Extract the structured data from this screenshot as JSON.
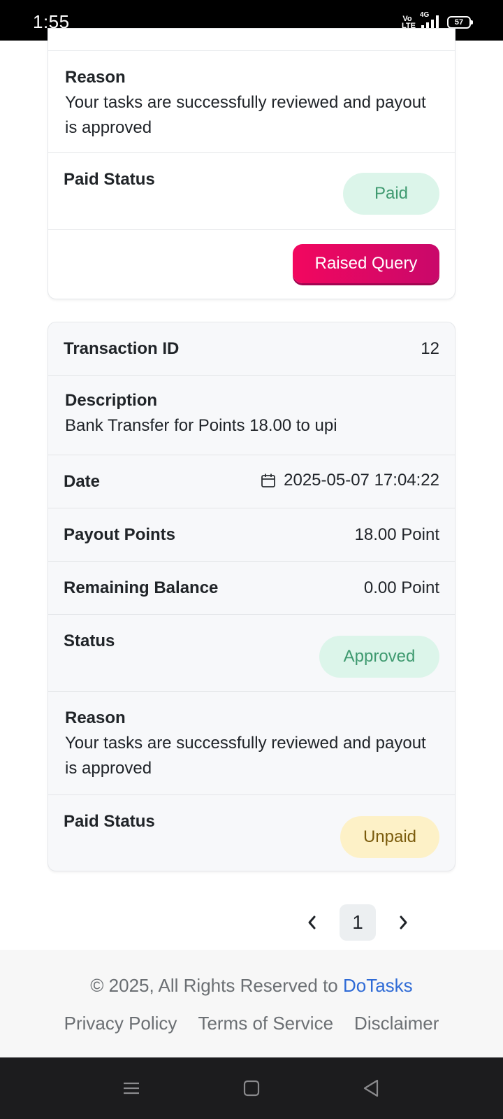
{
  "status_bar": {
    "time": "1:55",
    "volte": "Vo\nLTE",
    "network": "4G",
    "battery": "57"
  },
  "card_top": {
    "reason_label": "Reason",
    "reason_text": "Your tasks are successfully reviewed and payout is approved",
    "paid_status_label": "Paid Status",
    "paid_status_value": "Paid",
    "raise_query_label": "Raised Query"
  },
  "card_bottom": {
    "transaction_id_label": "Transaction ID",
    "transaction_id_value": "12",
    "description_label": "Description",
    "description_value": "Bank Transfer for Points 18.00 to upi",
    "date_label": "Date",
    "date_value": "2025-05-07 17:04:22",
    "payout_points_label": "Payout Points",
    "payout_points_value": "18.00 Point",
    "remaining_balance_label": "Remaining Balance",
    "remaining_balance_value": "0.00 Point",
    "status_label": "Status",
    "status_value": "Approved",
    "reason_label": "Reason",
    "reason_text": "Your tasks are successfully reviewed and payout is approved",
    "paid_status_label": "Paid Status",
    "paid_status_value": "Unpaid"
  },
  "pagination": {
    "current_page": "1",
    "prev_icon": "chevron-left-icon",
    "next_icon": "chevron-right-icon"
  },
  "footer": {
    "copyright_prefix": "© 2025, All Rights Reserved to ",
    "brand": "DoTasks",
    "links": [
      "Privacy Policy",
      "Terms of Service",
      "Disclaimer"
    ]
  },
  "colors": {
    "query_button": "#f2075f",
    "paid_pill_bg": "#dcf5ea",
    "paid_pill_text": "#3f9a70",
    "unpaid_pill_bg": "#fdf1c7",
    "unpaid_pill_text": "#7a5b0c",
    "brand_link": "#2f6bd6"
  }
}
